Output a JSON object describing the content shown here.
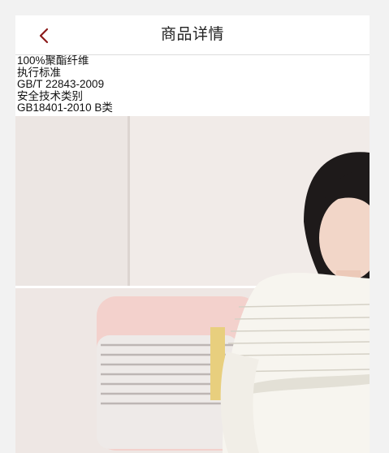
{
  "header": {
    "title": "商品详情",
    "back_icon": "chevron-left-icon",
    "accent_color": "#8b1a1a"
  },
  "specs": {
    "lines": [
      "100%聚酯纤维",
      "执行标准",
      "GB/T 22843-2009",
      "安全技术类别",
      "GB18401-2010 B类"
    ]
  },
  "product_image": {
    "description_icon": "product-photo"
  }
}
